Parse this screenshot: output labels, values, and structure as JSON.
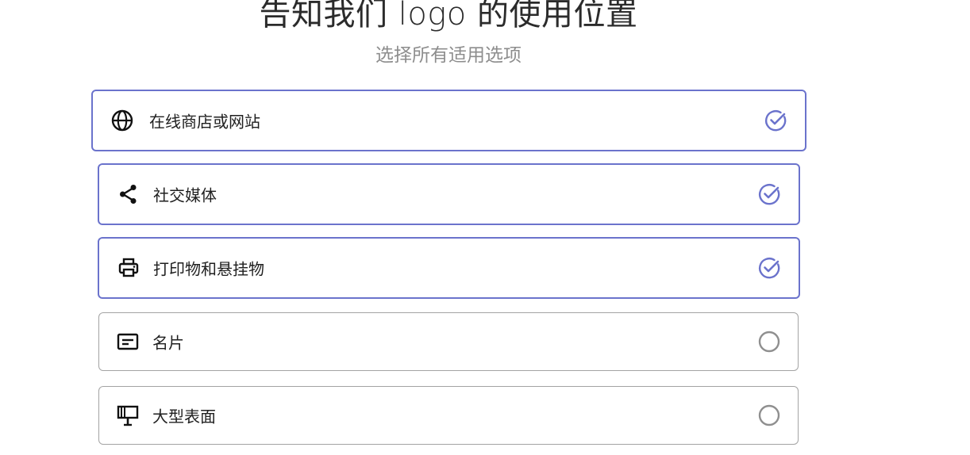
{
  "header": {
    "title": "告知我们 logo 的使用位置",
    "subtitle": "选择所有适用选项"
  },
  "colors": {
    "accent": "#6b73cc",
    "border": "#a3a3a3",
    "unselected_circle": "#8f8f8f"
  },
  "options": [
    {
      "label": "在线商店或网站",
      "icon": "globe-icon",
      "selected": true
    },
    {
      "label": "社交媒体",
      "icon": "share-icon",
      "selected": true
    },
    {
      "label": "打印物和悬挂物",
      "icon": "printer-icon",
      "selected": true
    },
    {
      "label": "名片",
      "icon": "business-card-icon",
      "selected": false
    },
    {
      "label": "大型表面",
      "icon": "billboard-icon",
      "selected": false
    }
  ]
}
